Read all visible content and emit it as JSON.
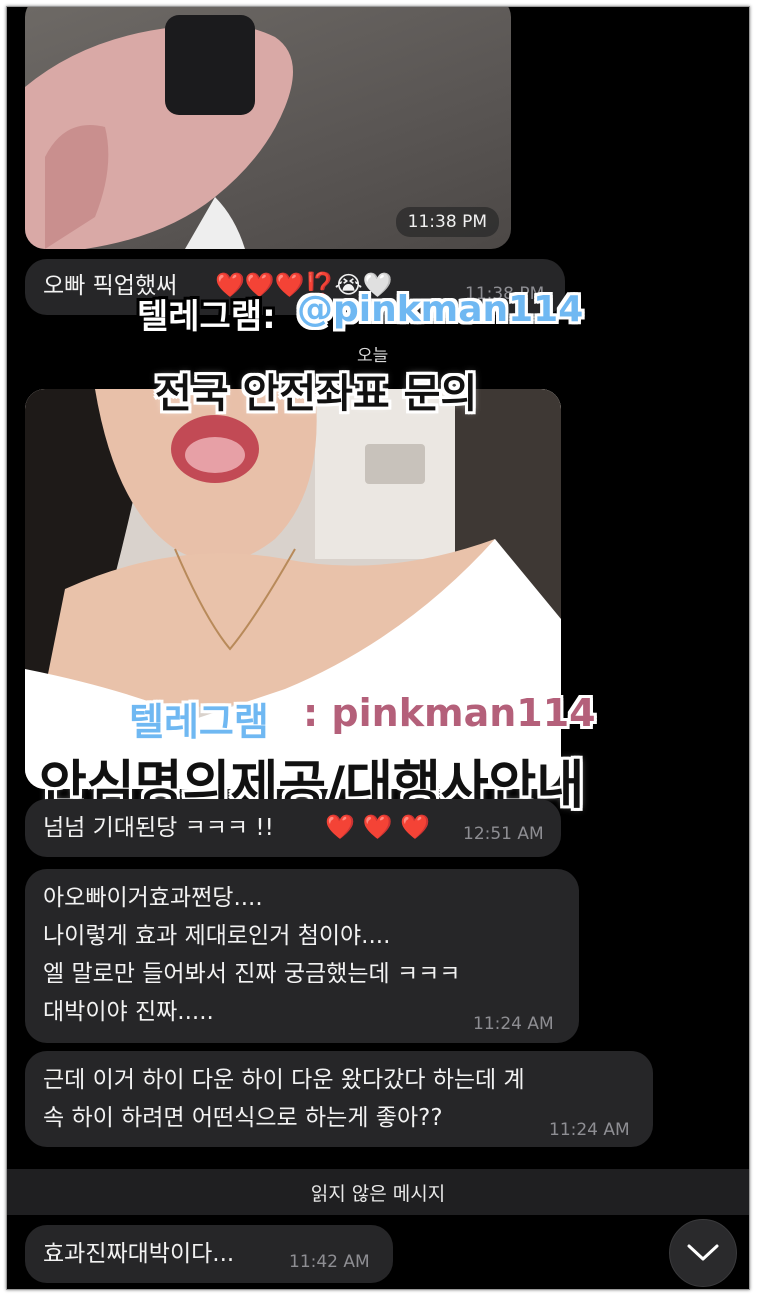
{
  "messages": {
    "photo1": {
      "time": "11:38 PM"
    },
    "msg1": {
      "text": "오빠 픽업했써",
      "emoji_tail": "❤️❤️❤️⁉️😭🤍",
      "time": "11:38 PM"
    },
    "day_label": "오늘",
    "msg2": {
      "text": "넘넘 기대된당 ㅋㅋㅋ !!",
      "hearts": "❤️ ❤️ ❤️",
      "time": "12:51 AM"
    },
    "msg3": {
      "lines": [
        "아오빠이거효과쩐당....",
        "나이렇게 효과 제대로인거 첨이야....",
        "엘 말로만 들어봐서 진짜 궁금했는데 ㅋㅋㅋ",
        "대박이야 진짜....."
      ],
      "time": "11:24 AM"
    },
    "msg4": {
      "lines": [
        "근데 이거 하이 다운 하이 다운 왔다갔다 하는데 계",
        "속 하이 하려면 어떤식으로 하는게 좋아??"
      ],
      "time": "11:24 AM"
    },
    "unread_divider": "읽지 않은 메시지",
    "msg5": {
      "text": "효과진짜대박이다...",
      "time": "11:42 AM"
    }
  },
  "overlays": {
    "telegram1_label": "텔레그램:",
    "telegram1_handle": "@pinkman114",
    "nationwide": "전국 안전좌표 문의",
    "telegram2_label": "텔레그램",
    "telegram2_handle": ": pinkman114",
    "safe_name": "안심명의제공/대행사안내"
  },
  "icons": {
    "scroll_down": "chevron-down-icon"
  },
  "colors": {
    "background": "#000000",
    "bubble": "#262628",
    "accent_blue": "#6fb8f2"
  }
}
